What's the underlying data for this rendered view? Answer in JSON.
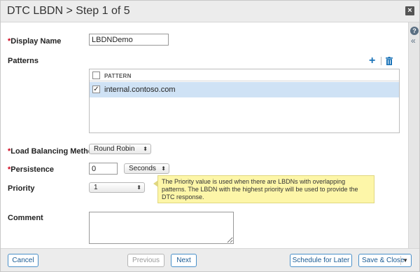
{
  "header": {
    "title": "DTC LBDN > Step 1 of 5",
    "close_icon": "close-icon"
  },
  "side": {
    "help": "?",
    "collapse": "«"
  },
  "form": {
    "display_name": {
      "required": "*",
      "label": "Display Name",
      "value": "LBDNDemo"
    },
    "patterns": {
      "label": "Patterns",
      "column_header": "PATTERN",
      "rows": [
        {
          "checked": true,
          "value": "internal.contoso.com"
        }
      ]
    },
    "lb_method": {
      "required": "*",
      "label": "Load Balancing Method",
      "value": "Round Robin"
    },
    "persistence": {
      "required": "*",
      "label": "Persistence",
      "value": "0",
      "unit": "Seconds"
    },
    "priority": {
      "label": "Priority",
      "value": "1"
    },
    "priority_tooltip": "The Priority value is used when there are LBDNs with overlapping patterns. The LBDN with the highest priority will be used to provide the DTC response.",
    "comment": {
      "label": "Comment",
      "value": ""
    }
  },
  "footer": {
    "cancel": "Cancel",
    "previous": "Previous",
    "next": "Next",
    "schedule": "Schedule for Later",
    "save_close": "Save & Close"
  },
  "colors": {
    "accent": "#1a73b8",
    "tooltip_bg": "#fdf6a8",
    "selected_row": "#cfe2f5",
    "required": "#d0021b"
  }
}
